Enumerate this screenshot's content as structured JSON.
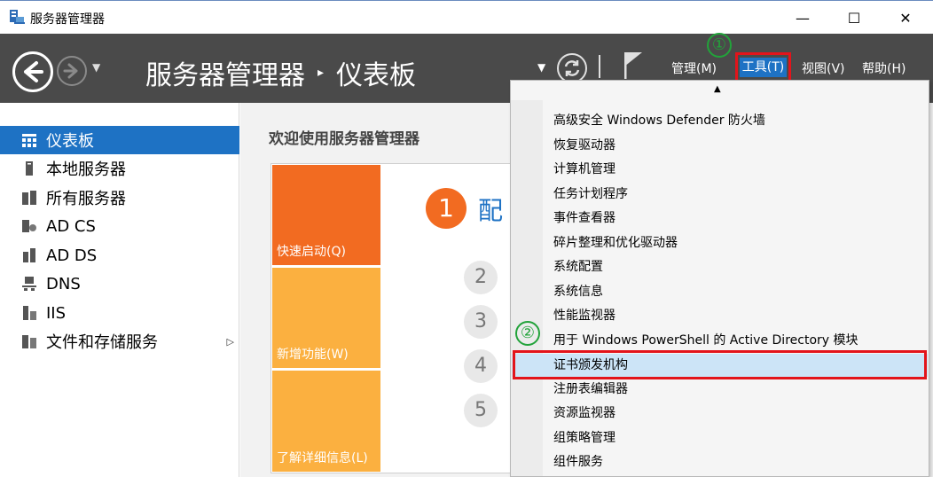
{
  "window": {
    "title": "服务器管理器",
    "controls": {
      "minimize": "—",
      "maximize": "☐",
      "close": "✕"
    }
  },
  "header": {
    "breadcrumb_root": "服务器管理器",
    "breadcrumb_separator": "▸",
    "breadcrumb_current": "仪表板",
    "menus": {
      "manage": "管理(M)",
      "tools": "工具(T)",
      "view": "视图(V)",
      "help": "帮助(H)"
    },
    "step_markers": {
      "one": "①",
      "two": "②"
    }
  },
  "sidebar": {
    "items": [
      {
        "label": "仪表板",
        "icon": "dashboard-icon",
        "active": true
      },
      {
        "label": "本地服务器",
        "icon": "server-icon"
      },
      {
        "label": "所有服务器",
        "icon": "servers-icon"
      },
      {
        "label": "AD CS",
        "icon": "adcs-icon"
      },
      {
        "label": "AD DS",
        "icon": "adds-icon"
      },
      {
        "label": "DNS",
        "icon": "dns-icon"
      },
      {
        "label": "IIS",
        "icon": "iis-icon"
      },
      {
        "label": "文件和存储服务",
        "icon": "storage-icon",
        "expand": "▷"
      }
    ]
  },
  "main": {
    "welcome": "欢迎使用服务器管理器",
    "tiles": {
      "quick_start": "快速启动(Q)",
      "whats_new": "新增功能(W)",
      "learn_more": "了解详细信息(L)"
    },
    "step_1_number": "1",
    "step_1_text": "配",
    "steps": [
      "2",
      "3",
      "4",
      "5"
    ]
  },
  "tools_menu": {
    "caret": "▲",
    "items": [
      "高级安全 Windows Defender 防火墙",
      "恢复驱动器",
      "计算机管理",
      "任务计划程序",
      "事件查看器",
      "碎片整理和优化驱动器",
      "系统配置",
      "系统信息",
      "性能监视器",
      "用于 Windows PowerShell 的 Active Directory 模块",
      "证书颁发机构",
      "注册表编辑器",
      "资源监视器",
      "组策略管理",
      "组件服务"
    ],
    "selected": "证书颁发机构"
  },
  "colors": {
    "header_bg": "#4a4a4a",
    "accent_blue": "#1e72c4",
    "tile_orange_dark": "#f26b21",
    "tile_orange_light": "#fbb040",
    "highlight_red": "#e3141b",
    "marker_green": "#22a33a",
    "menu_selection": "#cce4f7"
  }
}
